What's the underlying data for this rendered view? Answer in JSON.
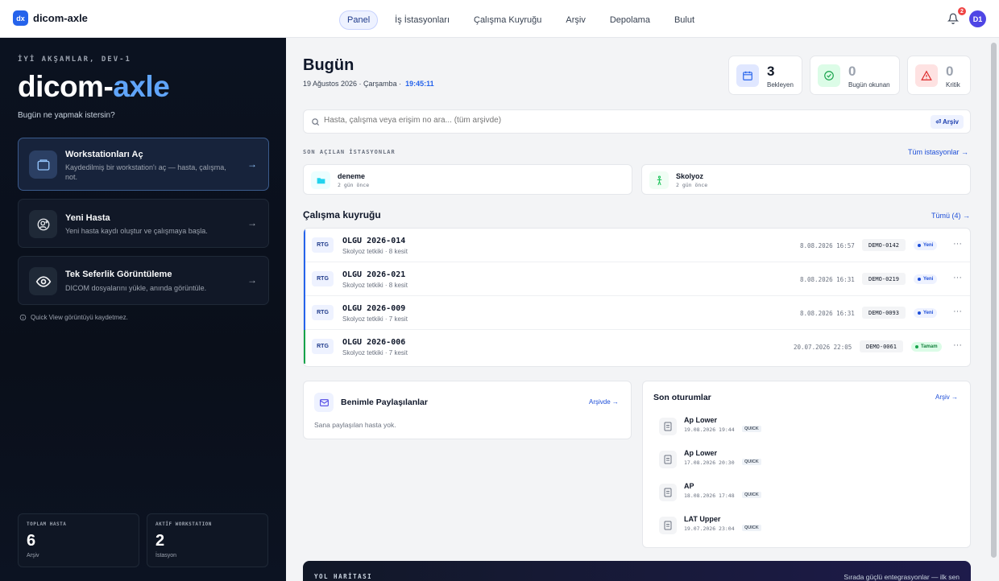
{
  "app": {
    "logo_text": "dx",
    "name": "dicom-axle"
  },
  "nav": {
    "items": [
      {
        "label": "Panel",
        "active": true
      },
      {
        "label": "İş İstasyonları"
      },
      {
        "label": "Çalışma Kuyruğu"
      },
      {
        "label": "Arşiv"
      },
      {
        "label": "Depolama"
      },
      {
        "label": "Bulut"
      }
    ],
    "notification_count": "2",
    "avatar_initials": "D1"
  },
  "sidebar": {
    "greeting": "İYİ AKŞAMLAR, DEV-1",
    "title_part1": "dicom-",
    "title_part2": "axle",
    "subtitle": "Bugün ne yapmak istersin?",
    "cards": [
      {
        "title": "Workstationları Aç",
        "desc": "Kaydedilmiş bir workstation'ı aç — hasta, çalışma, not.",
        "icon": "folder-icon"
      },
      {
        "title": "Yeni Hasta",
        "desc": "Yeni hasta kaydı oluştur ve çalışmaya başla.",
        "icon": "add-user-icon"
      },
      {
        "title": "Tek Seferlik Görüntüleme",
        "desc": "DICOM dosyalarını yükle, anında görüntüle.",
        "icon": "eye-icon"
      }
    ],
    "arrow": "→",
    "note": "Quick View görüntüyü kaydetmez.",
    "stats": [
      {
        "label": "TOPLAM HASTA",
        "value": "6",
        "sub": "Arşiv"
      },
      {
        "label": "AKTİF WORKSTATION",
        "value": "2",
        "sub": "İstasyon"
      }
    ]
  },
  "main": {
    "title": "Bugün",
    "date": "19 Ağustos 2026 · Çarşamba  ·",
    "time": "19:45:11",
    "kpis": [
      {
        "value": "3",
        "label": "Bekleyen",
        "color": "#111827",
        "icon_bg": "#eef2ff",
        "icon": "calendar-icon"
      },
      {
        "value": "0",
        "label": "Bugün okunan",
        "color": "#9ca3af",
        "icon_bg": "#ecfdf5",
        "icon": "check-badge-icon"
      },
      {
        "value": "0",
        "label": "Kritik",
        "color": "#9ca3af",
        "icon_bg": "#fef2f2",
        "icon": "warning-icon"
      }
    ],
    "search": {
      "placeholder": "Hasta, çalışma veya erişim no ara... (tüm arşivde)",
      "button": "⏎ Arşiv"
    },
    "recent_label": "SON AÇILAN İSTASYONLAR",
    "recent_link": "Tüm istasyonlar →",
    "recent": [
      {
        "name": "deneme",
        "time": "2 gün önce",
        "icon": "folder-icon"
      },
      {
        "name": "Skolyoz",
        "time": "2 gün önce",
        "icon": "figure-icon"
      }
    ],
    "queue_title": "Çalışma kuyruğu",
    "queue_link": "Tümü (4) →",
    "queue": [
      {
        "modality": "RTG",
        "title": "OLGU 2026-014",
        "sub": "Skolyoz tetkiki · 8 kesit",
        "date": "8.08.2026 16:57",
        "id": "DEMO-0142",
        "status": "Yeni"
      },
      {
        "modality": "RTG",
        "title": "OLGU 2026-021",
        "sub": "Skolyoz tetkiki · 8 kesit",
        "date": "8.08.2026 16:31",
        "id": "DEMO-0219",
        "status": "Yeni"
      },
      {
        "modality": "RTG",
        "title": "OLGU 2026-009",
        "sub": "Skolyoz tetkiki · 7 kesit",
        "date": "8.08.2026 16:31",
        "id": "DEMO-0093",
        "status": "Yeni"
      },
      {
        "modality": "RTG",
        "title": "OLGU 2026-006",
        "sub": "Skolyoz tetkiki · 7 kesit",
        "date": "20.07.2026 22:05",
        "id": "DEMO-0061",
        "status": "Tamam"
      }
    ],
    "more": "···",
    "shared": {
      "title": "Benimle Paylaşılanlar",
      "link": "Arşivde →",
      "empty": "Sana paylaşılan hasta yok."
    },
    "sessions": {
      "title": "Son oturumlar",
      "link": "Arşiv →",
      "items": [
        {
          "name": "Ap Lower",
          "time": "19.08.2026 19:44",
          "tag": "QUICK"
        },
        {
          "name": "Ap Lower",
          "time": "17.08.2026 20:30",
          "tag": "QUICK"
        },
        {
          "name": "AP",
          "time": "18.08.2026 17:48",
          "tag": "QUICK"
        },
        {
          "name": "LAT Upper",
          "time": "19.07.2026 23:04",
          "tag": "QUICK"
        }
      ]
    },
    "roadmap": {
      "label": "YOL HARİTASI",
      "text": "Sırada güçlü entegrasyonlar — ilk sen"
    }
  },
  "colors": {
    "accent": "#2563eb",
    "new_status": "#1d4ed8",
    "done_status": "#16a34a"
  }
}
